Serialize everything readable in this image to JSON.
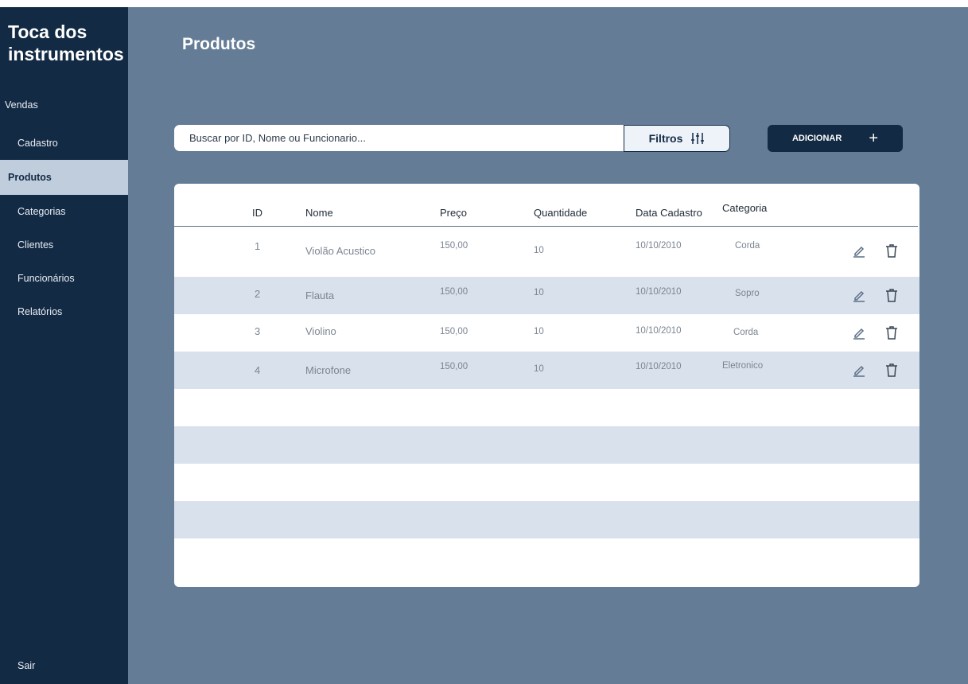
{
  "app": {
    "brand": "Toca dos instrumentos"
  },
  "sidebar": {
    "items": [
      {
        "label": "Vendas"
      },
      {
        "label": "Cadastro"
      },
      {
        "label": "Produtos"
      },
      {
        "label": "Categorias"
      },
      {
        "label": "Clientes"
      },
      {
        "label": "Funcionários"
      },
      {
        "label": "Relatórios"
      }
    ],
    "active": "Produtos",
    "logout_label": "Sair"
  },
  "page": {
    "title": "Produtos"
  },
  "search": {
    "placeholder": "Buscar por ID, Nome ou Funcionario..."
  },
  "toolbar": {
    "filter_label": "Filtros",
    "filter_icon": "sliders-icon",
    "add_label": "ADICIONAR",
    "add_icon": "plus-icon"
  },
  "table": {
    "columns": [
      "ID",
      "Nome",
      "Preço",
      "Quantidade",
      "Data Cadastro",
      "Categoria"
    ],
    "rows": [
      {
        "id": "1",
        "nome": "Violão Acustico",
        "preco": "150,00",
        "quantidade": "10",
        "data": "10/10/2010",
        "categoria": "Corda"
      },
      {
        "id": "2",
        "nome": "Flauta",
        "preco": "150,00",
        "quantidade": "10",
        "data": "10/10/2010",
        "categoria": "Sopro"
      },
      {
        "id": "3",
        "nome": "Violino",
        "preco": "150,00",
        "quantidade": "10",
        "data": "10/10/2010",
        "categoria": "Corda"
      },
      {
        "id": "4",
        "nome": "Microfone",
        "preco": "150,00",
        "quantidade": "10",
        "data": "10/10/2010",
        "categoria": "Eletronico"
      }
    ],
    "row_actions": [
      "pencil-icon",
      "trash-icon"
    ]
  },
  "colors": {
    "sidebar_bg": "#132a44",
    "content_bg": "#647c96",
    "active_item_bg": "#bfcddd",
    "row_alt_bg": "#d9e1ec",
    "action_icon": "#5b6f86"
  }
}
